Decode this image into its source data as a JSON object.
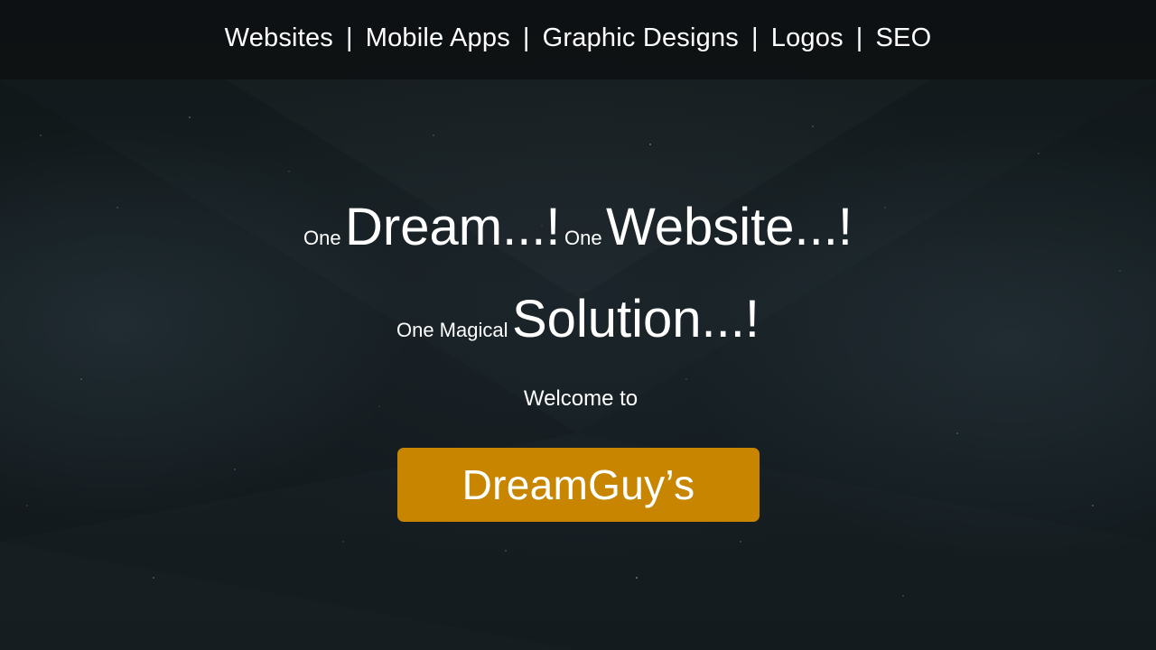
{
  "nav": {
    "items": [
      {
        "label": "Websites"
      },
      {
        "label": "Mobile Apps"
      },
      {
        "label": "Graphic Designs"
      },
      {
        "label": "Logos"
      },
      {
        "label": "SEO"
      }
    ],
    "separator": "|"
  },
  "hero": {
    "line1": {
      "prefix1": "One",
      "word1": "Dream...!",
      "prefix2": "One",
      "word2": "Website...!"
    },
    "line2": {
      "prefix": "One Magical",
      "word": "Solution...!"
    },
    "welcome": "Welcome to",
    "brand": "DreamGuy’s"
  },
  "colors": {
    "background": "#131a1e",
    "navbar": "#0c0f11",
    "brand_button": "#c78500",
    "text": "#ffffff"
  }
}
